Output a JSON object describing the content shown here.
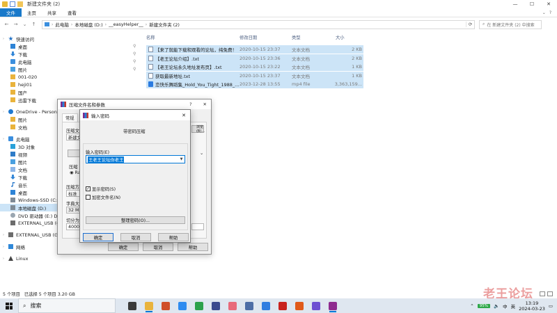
{
  "window": {
    "title": "新建文件夹 (2)",
    "controls": [
      "—",
      "☐",
      "✕"
    ]
  },
  "ribbon": {
    "tabs": [
      "文件",
      "主页",
      "共享",
      "查看"
    ],
    "help": "?"
  },
  "address": {
    "crumbs": [
      "此电脑",
      "本地磁盘 (D:)",
      "__easyHelper__",
      "新建文件夹 (2)"
    ],
    "search_placeholder": "在 新建文件夹 (2) 中搜索"
  },
  "nav": [
    {
      "label": "快速访问",
      "icon": "star-icon",
      "cls": "ic-star",
      "indent": 0,
      "chev": true
    },
    {
      "label": "桌面",
      "icon": "desktop-icon",
      "cls": "ic-desk",
      "indent": 1,
      "pin": true
    },
    {
      "label": "下载",
      "icon": "download-icon",
      "cls": "ic-down",
      "indent": 1,
      "pin": true
    },
    {
      "label": "此电脑",
      "icon": "computer-icon",
      "cls": "ic-pc",
      "indent": 1,
      "pin": true
    },
    {
      "label": "图片",
      "icon": "pictures-icon",
      "cls": "ic-pic",
      "indent": 1,
      "pin": true
    },
    {
      "label": "001-020",
      "icon": "folder-icon",
      "cls": "ic-fold",
      "indent": 1
    },
    {
      "label": "heji01",
      "icon": "folder-icon",
      "cls": "ic-fold",
      "indent": 1
    },
    {
      "label": "国产",
      "icon": "folder-icon",
      "cls": "ic-fold",
      "indent": 1
    },
    {
      "label": "迅雷下载",
      "icon": "folder-icon",
      "cls": "ic-fold",
      "indent": 1
    },
    {
      "label": "OneDrive - Personal",
      "icon": "onedrive-icon",
      "cls": "ic-cloud",
      "indent": 0,
      "chev": true
    },
    {
      "label": "图片",
      "icon": "folder-icon",
      "cls": "ic-fold",
      "indent": 1
    },
    {
      "label": "文档",
      "icon": "folder-icon",
      "cls": "ic-fold",
      "indent": 1
    },
    {
      "label": "此电脑",
      "icon": "computer-icon",
      "cls": "ic-pc",
      "indent": 0,
      "chev": true
    },
    {
      "label": "3D 对象",
      "icon": "3d-objects-icon",
      "cls": "ic-3d",
      "indent": 1
    },
    {
      "label": "视频",
      "icon": "videos-icon",
      "cls": "ic-video",
      "indent": 1
    },
    {
      "label": "图片",
      "icon": "pictures-icon",
      "cls": "ic-pic",
      "indent": 1
    },
    {
      "label": "文档",
      "icon": "documents-icon",
      "cls": "ic-doc",
      "indent": 1
    },
    {
      "label": "下载",
      "icon": "download-icon",
      "cls": "ic-down",
      "indent": 1
    },
    {
      "label": "音乐",
      "icon": "music-icon",
      "cls": "ic-music",
      "indent": 1
    },
    {
      "label": "桌面",
      "icon": "desktop-icon",
      "cls": "ic-desk",
      "indent": 1
    },
    {
      "label": "Windows-SSD (C:)",
      "icon": "drive-icon",
      "cls": "ic-drive",
      "indent": 1
    },
    {
      "label": "本地磁盘 (D:)",
      "icon": "drive-icon",
      "cls": "ic-drive",
      "indent": 1,
      "selected": true
    },
    {
      "label": "DVD 驱动器 (E:) DU",
      "icon": "dvd-icon",
      "cls": "ic-dvd",
      "indent": 1
    },
    {
      "label": "EXTERNAL_USB (G:)",
      "icon": "usb-drive-icon",
      "cls": "ic-usb",
      "indent": 1
    },
    {
      "label": "EXTERNAL_USB (G:)",
      "icon": "usb-drive-icon",
      "cls": "ic-usb",
      "indent": 0,
      "chev": true
    },
    {
      "label": "网络",
      "icon": "network-icon",
      "cls": "ic-net",
      "indent": 0,
      "chev": true
    },
    {
      "label": "Linux",
      "icon": "linux-icon",
      "cls": "ic-linux",
      "indent": 0,
      "chev": true
    }
  ],
  "filelist": {
    "columns": [
      "名称",
      "修改日期",
      "类型",
      "大小"
    ],
    "rows": [
      {
        "name": "【来了就能下载和观看的论坛，纯免费！",
        "date": "2020-10-15 23:37",
        "type": "文本文档",
        "size": "2 KB",
        "kind": "txt"
      },
      {
        "name": "【老王论坛介绍】.txt",
        "date": "2020-10-15 23:36",
        "type": "文本文档",
        "size": "2 KB",
        "kind": "txt"
      },
      {
        "name": "【老王论坛永久地址发布页】.txt",
        "date": "2020-10-15 23:22",
        "type": "文本文档",
        "size": "1 KB",
        "kind": "txt"
      },
      {
        "name": "获取最新地址.txt",
        "date": "2020-10-15 23:37",
        "type": "文本文档",
        "size": "1 KB",
        "kind": "txt"
      },
      {
        "name": "恋快乐舞蹈集_Hold_You_Tight_1988_...",
        "date": "2023-12-28 13:55",
        "type": "mp4 file",
        "size": "3,363,159...",
        "kind": "mp4"
      }
    ]
  },
  "status": {
    "count": "5 个项目",
    "selected": "已选择 5 个项目  3.20 GB"
  },
  "dialog1": {
    "title": "压缩文件名和参数",
    "help": "?",
    "tab": "常规",
    "fragments": [
      "压缩文",
      "新建文",
      "压缩",
      "Ra",
      "压缩方",
      "标准",
      "字典大",
      "32 MB",
      "切分为",
      "4000"
    ],
    "browse": "浏览(B)...",
    "ok": "确定",
    "cancel": "取消",
    "help_btn": "帮助"
  },
  "dialog2": {
    "title": "输入密码",
    "heading": "带密码压缩",
    "pw_label": "输入密码(E)",
    "pw_value": "王老王论坛你老王",
    "show_pw": "显示密码(S)",
    "encrypt_names": "加密文件名(N)",
    "organize": "整理密码(O)...",
    "ok": "确定",
    "cancel": "取消",
    "help": "帮助"
  },
  "taskbar": {
    "search": "搜索",
    "apps": [
      {
        "name": "taskview-icon",
        "color": "#3a3a3a"
      },
      {
        "name": "file-explorer-icon",
        "color": "#e9b33c"
      },
      {
        "name": "picture-app-icon",
        "color": "#d04f2a"
      },
      {
        "name": "send-app-icon",
        "color": "#2e8cf0"
      },
      {
        "name": "chrome-icon",
        "color": "#2ca24c"
      },
      {
        "name": "app-icon",
        "color": "#3a4a8e"
      },
      {
        "name": "music-app-icon",
        "color": "#e86a7a"
      },
      {
        "name": "app-icon",
        "color": "#4d6ea6"
      },
      {
        "name": "baidu-netdisk-icon",
        "color": "#2f7de0"
      },
      {
        "name": "record-app-icon",
        "color": "#c8221e"
      },
      {
        "name": "app-icon",
        "color": "#e05a1a"
      },
      {
        "name": "app-icon",
        "color": "#6d4fd2"
      },
      {
        "name": "winrar-icon",
        "color": "#8e2b8f"
      }
    ],
    "tray": {
      "battery": "95%",
      "ime": "中",
      "lang": "英",
      "time": "13:19",
      "date": "2024-03-23"
    }
  },
  "watermark": "老王论坛"
}
